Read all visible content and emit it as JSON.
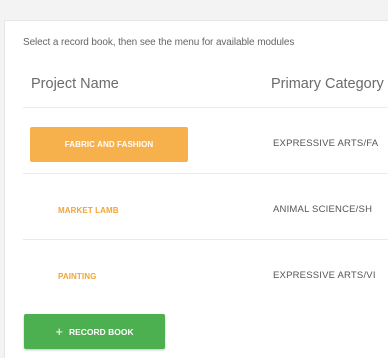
{
  "instructions": "Select a record book, then see the menu for available modules",
  "table": {
    "headers": {
      "project_name": "Project Name",
      "primary_category": "Primary Category"
    },
    "rows": [
      {
        "project": "FABRIC AND FASHION",
        "category": "EXPRESSIVE ARTS/FA",
        "selected": true
      },
      {
        "project": "MARKET LAMB",
        "category": "ANIMAL SCIENCE/SH",
        "selected": false
      },
      {
        "project": "PAINTING",
        "category": "EXPRESSIVE ARTS/VI",
        "selected": false
      }
    ]
  },
  "add_button": {
    "icon": "plus-icon",
    "icon_glyph": "+",
    "label": "RECORD BOOK"
  },
  "colors": {
    "accent_orange": "#f6b04c",
    "link_orange": "#f0a537",
    "action_green": "#4caf50"
  }
}
